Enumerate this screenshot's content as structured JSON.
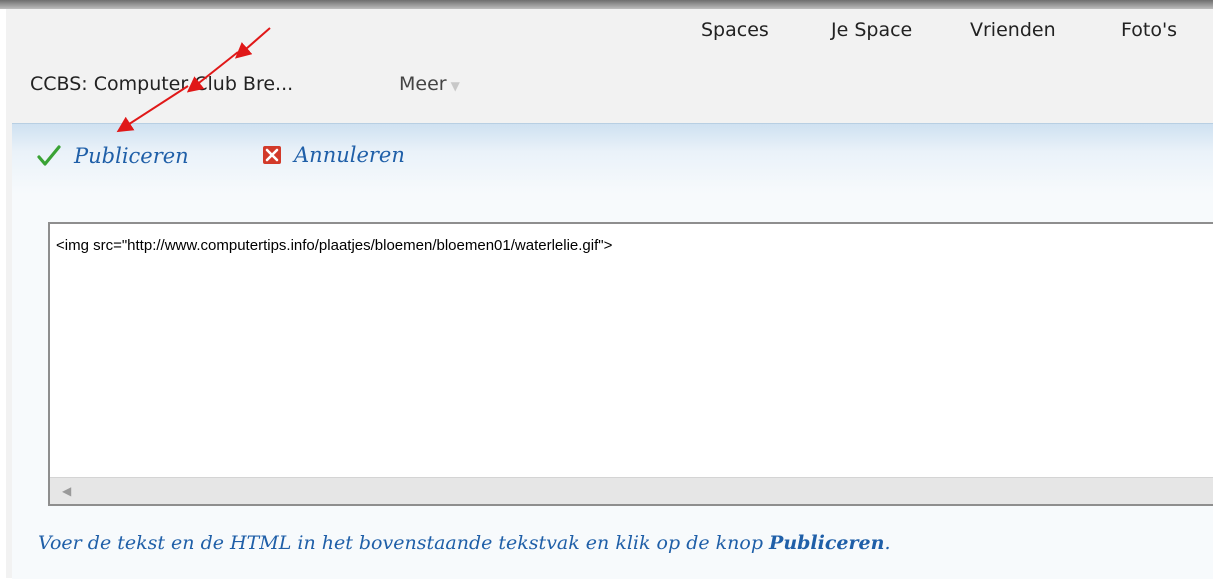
{
  "top_nav": {
    "items": [
      {
        "label": "Spaces"
      },
      {
        "label": "Je Space"
      },
      {
        "label": "Vrienden"
      },
      {
        "label": "Foto's"
      }
    ]
  },
  "sub_nav": {
    "site_title": "CCBS: Computer Club Bre...",
    "more_label": "Meer",
    "more_icon": "chevron-down-icon"
  },
  "toolbar": {
    "publish_label": "Publiceren",
    "publish_icon": "checkmark-icon",
    "cancel_label": "Annuleren",
    "cancel_icon": "close-icon"
  },
  "editor": {
    "content": "<img src=\"http://www.computertips.info/plaatjes/bloemen/bloemen01/waterlelie.gif\">"
  },
  "hint": {
    "text_before": "Voer de tekst en de HTML in het bovenstaande tekstvak en klik op de knop ",
    "strong": "Publiceren",
    "text_after": "."
  },
  "colors": {
    "link_blue": "#1f5fa8",
    "check_green": "#3aa335",
    "cancel_red": "#d23a2a",
    "arrow_red": "#e01818"
  }
}
